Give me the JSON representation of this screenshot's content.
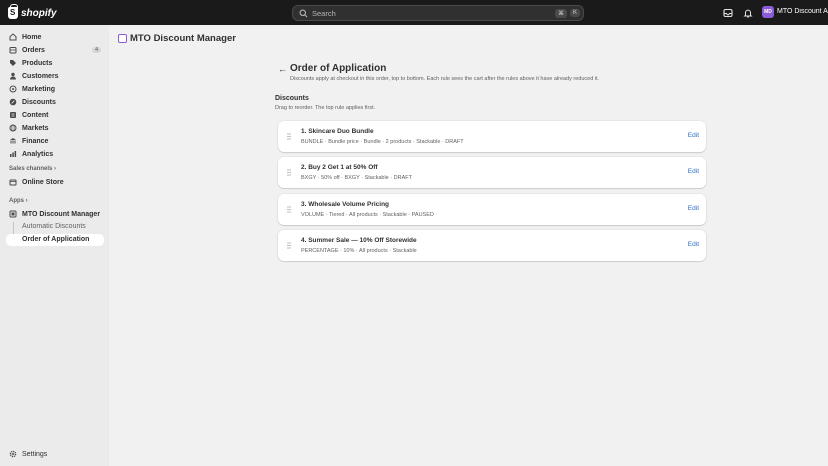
{
  "topbar": {
    "brand": "shopify",
    "search_placeholder": "Search",
    "shortcut_cmd": "⌘",
    "shortcut_key": "K",
    "store_initials": "MD",
    "store_name": "MTO Discount App"
  },
  "sidebar": {
    "items": [
      {
        "label": "Home",
        "icon": "home-icon"
      },
      {
        "label": "Orders",
        "icon": "orders-icon",
        "count": "4"
      },
      {
        "label": "Products",
        "icon": "tag-icon"
      },
      {
        "label": "Customers",
        "icon": "person-icon"
      },
      {
        "label": "Marketing",
        "icon": "target-icon"
      },
      {
        "label": "Discounts",
        "icon": "discount-icon"
      },
      {
        "label": "Content",
        "icon": "content-icon"
      },
      {
        "label": "Markets",
        "icon": "globe-icon"
      },
      {
        "label": "Finance",
        "icon": "bank-icon"
      },
      {
        "label": "Analytics",
        "icon": "chart-icon"
      }
    ],
    "sales_channels_label": "Sales channels",
    "online_store": "Online Store",
    "apps_label": "Apps",
    "app_name": "MTO Discount Manager",
    "sub_automatic": "Automatic Discounts",
    "sub_order": "Order of Application",
    "settings": "Settings"
  },
  "main": {
    "app_title": "MTO Discount Manager",
    "page_title": "Order of Application",
    "page_desc": "Discounts apply at checkout in this order, top to bottom. Each rule sees the cart after the rules above it have already reduced it.",
    "section_title": "Discounts",
    "section_desc": "Drag to reorder. The top rule applies first.",
    "edit_label": "Edit",
    "rules": [
      {
        "title": "1.  Skincare Duo Bundle",
        "meta": "BUNDLE  ·  Bundle price  ·  Bundle · 2 products  ·  Stackable  ·  DRAFT"
      },
      {
        "title": "2.  Buy 2 Get 1 at 50% Off",
        "meta": "BXGY  ·  50% off  ·  BXGY  ·  Stackable  ·  DRAFT"
      },
      {
        "title": "3.  Wholesale Volume Pricing",
        "meta": "VOLUME  ·  Tiered  ·  All products  ·  Stackable  ·  PAUSED"
      },
      {
        "title": "4.  Summer Sale — 10% Off Storewide",
        "meta": "PERCENTAGE  ·  10%  ·  All products  ·  Stackable"
      }
    ]
  }
}
